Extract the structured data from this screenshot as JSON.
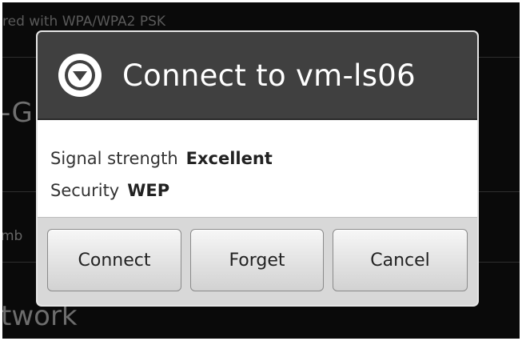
{
  "background": {
    "subtitle": "red with WPA/WPA2 PSK",
    "title_fragment": "-G",
    "number_fragment": "mb",
    "network_fragment": "twork"
  },
  "dialog": {
    "title": "Connect to vm-ls06",
    "icon": "wifi-dropdown-circle-icon",
    "rows": [
      {
        "label": "Signal strength",
        "value": "Excellent"
      },
      {
        "label": "Security",
        "value": "WEP"
      }
    ],
    "buttons": {
      "connect": "Connect",
      "forget": "Forget",
      "cancel": "Cancel"
    }
  },
  "colors": {
    "header_bg": "#404040",
    "body_bg": "#ffffff",
    "footer_bg": "#d8d8d8"
  }
}
